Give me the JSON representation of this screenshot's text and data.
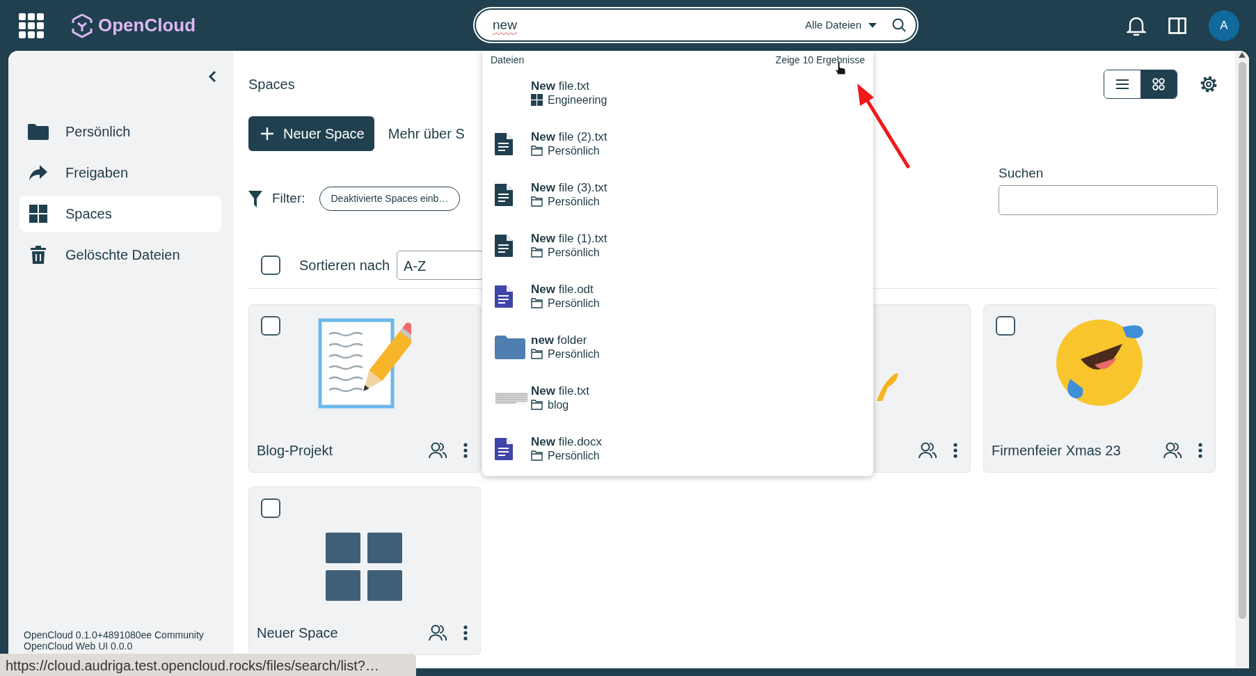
{
  "topbar": {
    "logo_text": "OpenCloud",
    "search": {
      "value": "new",
      "scope": "Alle Dateien"
    },
    "avatar": "A"
  },
  "sidebar": {
    "items": [
      {
        "label": "Persönlich",
        "kind": "folder",
        "selected": false
      },
      {
        "label": "Freigaben",
        "kind": "share",
        "selected": false
      },
      {
        "label": "Spaces",
        "kind": "grid",
        "selected": true
      },
      {
        "label": "Gelöschte Dateien",
        "kind": "trash",
        "selected": false
      }
    ],
    "version_lines": [
      "OpenCloud 0.1.0+4891080ee Community",
      "OpenCloud Web UI 0.0.0"
    ]
  },
  "content": {
    "title": "Spaces",
    "new_button": "Neuer Space",
    "more_link": "Mehr über S",
    "filter_label": "Filter:",
    "filter_chip": "Deaktivierte Spaces einb…",
    "select_all": {
      "checked": false
    },
    "sort_label": "Sortieren nach",
    "sort_value": "A-Z",
    "search_label": "Suchen",
    "view_modes": [
      {
        "kind": "list",
        "selected": false
      },
      {
        "kind": "tiles",
        "selected": true
      }
    ]
  },
  "cards": [
    {
      "kind": "notepad",
      "title": "Blog-Projekt",
      "checked": false
    },
    {
      "kind": "covered"
    },
    {
      "kind": "hand"
    },
    {
      "kind": "laughing",
      "title": "Firmenfeier Xmas 23",
      "checked": false
    },
    {
      "kind": "grid",
      "title": "Neuer Space",
      "checked": false
    }
  ],
  "search_dropdown": {
    "heading": "Dateien",
    "show_all": "Zeige 10 Ergebnisse",
    "results": [
      {
        "name": "**New** file.txt",
        "location": {
          "text": "Engineering",
          "kind": "space"
        },
        "kind": "none"
      },
      {
        "name": "**New** file (2).txt",
        "location": {
          "text": "Persönlich",
          "kind": "folder"
        },
        "kind": "text"
      },
      {
        "name": "**New** file (3).txt",
        "location": {
          "text": "Persönlich",
          "kind": "folder"
        },
        "kind": "text"
      },
      {
        "name": "**New** file (1).txt",
        "location": {
          "text": "Persönlich",
          "kind": "folder"
        },
        "kind": "text"
      },
      {
        "name": "**New** file.odt",
        "location": {
          "text": "Persönlich",
          "kind": "folder"
        },
        "kind": "document"
      },
      {
        "name": "**new** folder",
        "location": {
          "text": "Persönlich",
          "kind": "folder"
        },
        "kind": "folder"
      },
      {
        "name": "**New** file.txt",
        "location": {
          "text": "blog",
          "kind": "folder"
        },
        "kind": "preview"
      },
      {
        "name": "**New** file.docx",
        "location": {
          "text": "Persönlich",
          "kind": "folder"
        },
        "kind": "document"
      }
    ]
  },
  "status_url": "https://cloud.audriga.test.opencloud.rocks/files/search/list?…"
}
